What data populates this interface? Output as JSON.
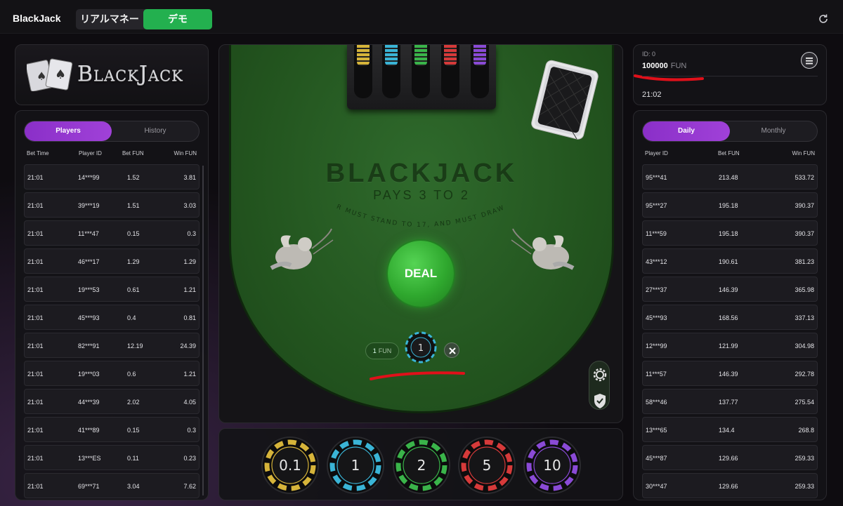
{
  "header": {
    "app_title": "BlackJack",
    "mode_real": "リアルマネー",
    "mode_demo": "デモ",
    "refresh_icon": "refresh-icon",
    "demo_color": "#23b04f"
  },
  "logo": {
    "text": "BlackJack"
  },
  "left_panel": {
    "tabs": [
      {
        "label": "Players",
        "active": true
      },
      {
        "label": "History",
        "active": false
      }
    ],
    "columns": [
      "Bet Time",
      "Player ID",
      "Bet  FUN",
      "Win  FUN"
    ],
    "rows": [
      [
        "21:01",
        "14***99",
        "1.52",
        "3.81"
      ],
      [
        "21:01",
        "39***19",
        "1.51",
        "3.03"
      ],
      [
        "21:01",
        "11***47",
        "0.15",
        "0.3"
      ],
      [
        "21:01",
        "46***17",
        "1.29",
        "1.29"
      ],
      [
        "21:01",
        "19***53",
        "0.61",
        "1.21"
      ],
      [
        "21:01",
        "45***93",
        "0.4",
        "0.81"
      ],
      [
        "21:01",
        "82***91",
        "12.19",
        "24.39"
      ],
      [
        "21:01",
        "19***03",
        "0.6",
        "1.21"
      ],
      [
        "21:01",
        "44***39",
        "2.02",
        "4.05"
      ],
      [
        "21:01",
        "41***89",
        "0.15",
        "0.3"
      ],
      [
        "21:01",
        "13***ES",
        "0.11",
        "0.23"
      ],
      [
        "21:01",
        "69***71",
        "3.04",
        "7.62"
      ]
    ]
  },
  "account": {
    "id_label": "ID: 0",
    "balance": "100000",
    "unit": "FUN",
    "time": "21:02",
    "menu_icon": "hamburger-menu-icon"
  },
  "right_panel": {
    "tabs": [
      {
        "label": "Daily",
        "active": true
      },
      {
        "label": "Monthly",
        "active": false
      }
    ],
    "columns": [
      "Player ID",
      "Bet  FUN",
      "Win  FUN"
    ],
    "rows": [
      [
        "95***41",
        "213.48",
        "533.72"
      ],
      [
        "95***27",
        "195.18",
        "390.37"
      ],
      [
        "11***59",
        "195.18",
        "390.37"
      ],
      [
        "43***12",
        "190.61",
        "381.23"
      ],
      [
        "27***37",
        "146.39",
        "365.98"
      ],
      [
        "45***93",
        "168.56",
        "337.13"
      ],
      [
        "12***99",
        "121.99",
        "304.98"
      ],
      [
        "11***57",
        "146.39",
        "292.78"
      ],
      [
        "58***46",
        "137.77",
        "275.54"
      ],
      [
        "13***65",
        "134.4",
        "268.8"
      ],
      [
        "45***87",
        "129.66",
        "259.33"
      ],
      [
        "30***47",
        "129.66",
        "259.33"
      ]
    ]
  },
  "table": {
    "title": "BLACKJACK",
    "subtitle": "PAYS 3 TO 2",
    "rule": "DEALER MUST STAND TO 17, AND MUST DRAW TO 16",
    "deal_label": "DEAL",
    "bet_amount": "1",
    "bet_unit": "FUN",
    "bet_chip_value": "1",
    "settings_icon": "gear-icon",
    "shield_icon": "shield-check-icon"
  },
  "chips": [
    {
      "label": "0.1",
      "color": "#d6b43a"
    },
    {
      "label": "1",
      "color": "#3ab4d6"
    },
    {
      "label": "2",
      "color": "#3ab44a"
    },
    {
      "label": "5",
      "color": "#d63a3a"
    },
    {
      "label": "10",
      "color": "#8a4ad6"
    }
  ]
}
